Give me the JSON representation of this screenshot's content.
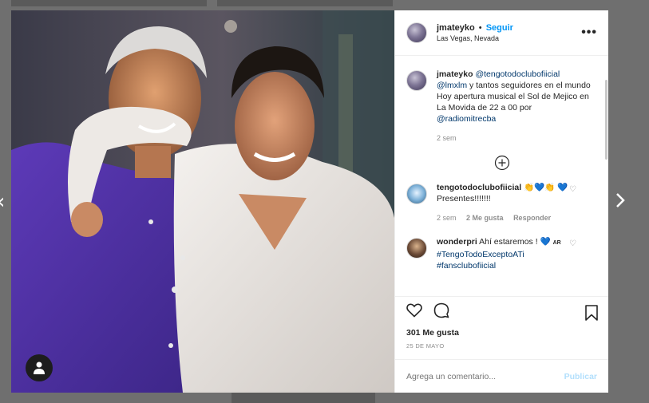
{
  "post": {
    "username": "jmateyko",
    "dot": "•",
    "follow_label": "Seguir",
    "location": "Las Vegas, Nevada",
    "more_label": "•••"
  },
  "caption": {
    "username": "jmateyko",
    "mention1": "@tengotodoclubofiicial",
    "mention2": "@lmxlm",
    "text1": "y tantos seguidores en el mundo",
    "text2": "Hoy apertura musical el Sol de Mejico en La Movida de 22 a 00 por",
    "mention3": "@radiomitrecba",
    "time": "2 sem"
  },
  "comments": [
    {
      "username": "tengotodoclubofiicial",
      "text": "👏💙👏 💙 Presentes!!!!!!!",
      "time": "2 sem",
      "likes": "2 Me gusta",
      "reply": "Responder"
    },
    {
      "username": "wonderpri",
      "text": "Ahí estaremos ! 💙",
      "badge": "AR",
      "tag1": "#TengoTodoExceptoATi",
      "tag2": "#fansclubofiicial"
    }
  ],
  "stats": {
    "likes": "301 Me gusta",
    "date": "25 DE MAYO"
  },
  "add_comment": {
    "placeholder": "Agrega un comentario...",
    "publish": "Publicar"
  },
  "icons": {
    "left_nav": "chevron-left-icon",
    "right_nav": "chevron-right-icon",
    "like": "heart-icon",
    "comment": "comment-icon",
    "save": "bookmark-icon",
    "more": "more-options-icon",
    "load_more": "plus-circle-icon",
    "tags": "user-tag-icon"
  },
  "colors": {
    "link": "#00376b",
    "follow": "#0095f6",
    "publish_disabled": "#b2dffc"
  }
}
